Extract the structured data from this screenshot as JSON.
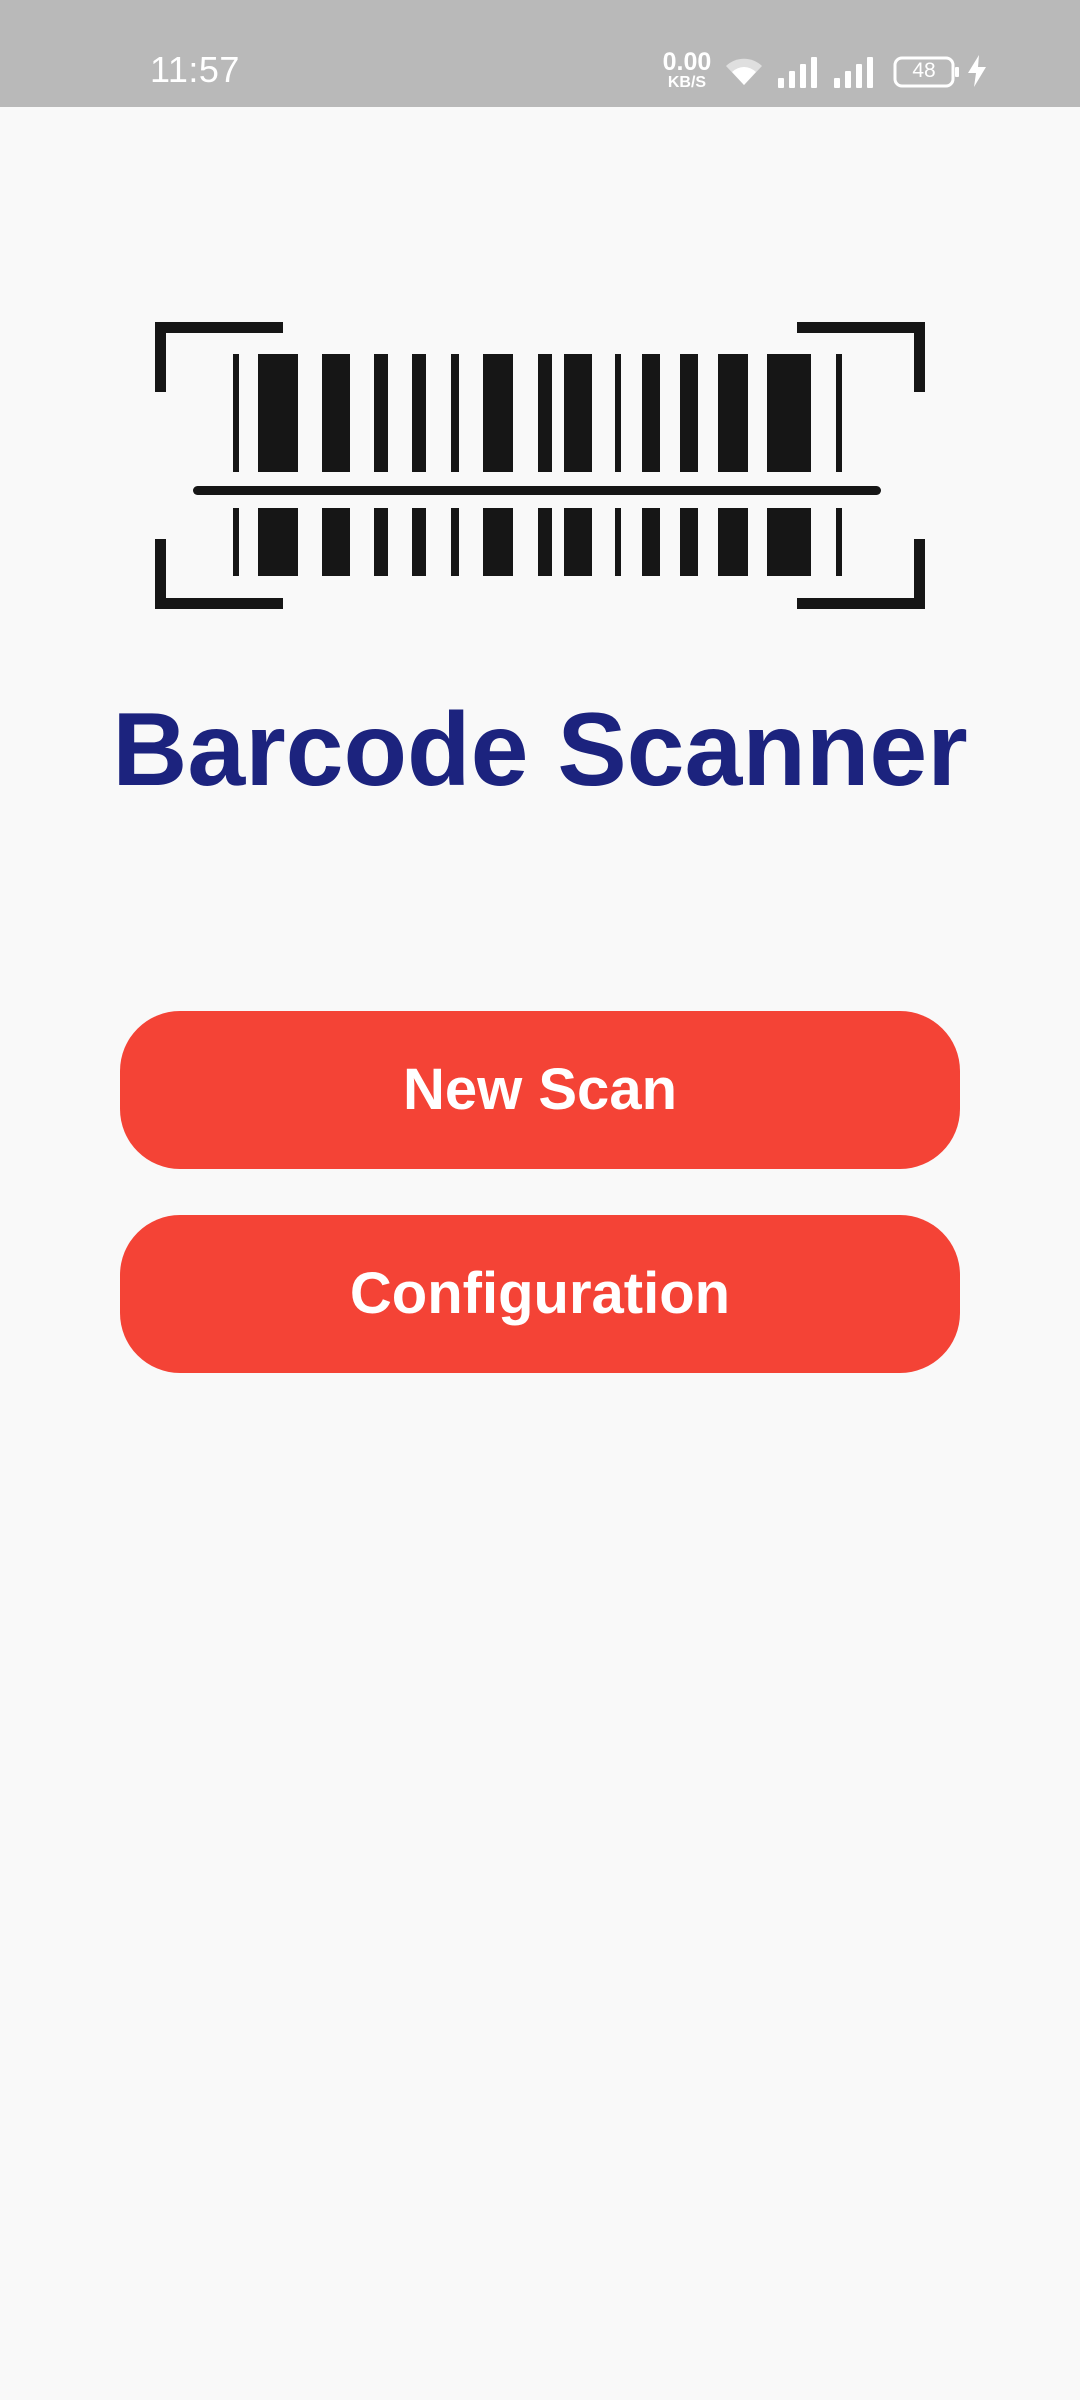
{
  "status_bar": {
    "time": "11:57",
    "net_speed_value": "0.00",
    "net_speed_unit": "KB/S",
    "battery_level": "48",
    "icons": [
      "wifi-icon",
      "signal-icon",
      "signal-icon",
      "battery-icon",
      "charging-icon"
    ]
  },
  "app": {
    "title": "Barcode Scanner",
    "logo_icon": "barcode-scanner-icon"
  },
  "buttons": {
    "new_scan": "New Scan",
    "configuration": "Configuration"
  },
  "colors": {
    "status_bar_bg": "#b9b9b9",
    "background": "#f9f9f9",
    "title": "#1c237e",
    "button": "#f44336",
    "button_text": "#ffffff",
    "logo": "#161616"
  }
}
